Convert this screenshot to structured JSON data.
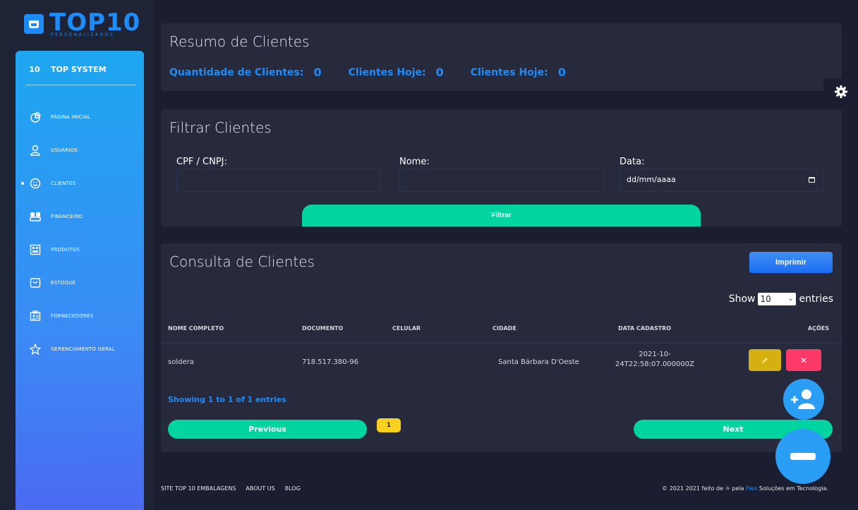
{
  "logo": {
    "main": "TOP10",
    "sub": "PERSONALIZADOS"
  },
  "brand": {
    "num": "10",
    "name": "TOP SYSTEM"
  },
  "nav": [
    {
      "label": "PÁGINA INICIAL",
      "icon": "pie-chart-icon"
    },
    {
      "label": "USUÁRIOS",
      "icon": "user-icon"
    },
    {
      "label": "CLIENTES",
      "icon": "smile-icon",
      "active": true
    },
    {
      "label": "FINANCEIRO",
      "icon": "money-icon"
    },
    {
      "label": "PRODUTOS",
      "icon": "product-icon"
    },
    {
      "label": "ESTOQUE",
      "icon": "stock-icon"
    },
    {
      "label": "FORNECEDORES",
      "icon": "supplier-icon"
    },
    {
      "label": "GERENCIAMENTO GERAL",
      "icon": "gear-star-icon"
    }
  ],
  "summary": {
    "title": "Resumo de Clientes",
    "stats": [
      {
        "label": "Quantidade de Clientes:",
        "value": "0"
      },
      {
        "label": "Clientes Hoje:",
        "value": "0"
      },
      {
        "label": "Clientes Hoje:",
        "value": "0"
      }
    ]
  },
  "filter": {
    "title": "Filtrar Clientes",
    "cpf_label": "CPF / CNPJ:",
    "nome_label": "Nome:",
    "data_label": "Data:",
    "date_placeholder": "dd/mm/aaaa",
    "button": "Filtrar"
  },
  "consulta": {
    "title": "Consulta de Clientes",
    "print_button": "Imprimir",
    "show_label": "Show",
    "entries_value": "10",
    "entries_label": "entries",
    "columns": [
      "NOME COMPLETO",
      "DOCUMENTO",
      "CELULAR",
      "CIDADE",
      "DATA CADASTRO",
      "AÇÕES"
    ],
    "rows": [
      {
        "nome": "soldera",
        "documento": "718.517.380-96",
        "celular": "",
        "cidade": "Santa Bárbara D'Oeste",
        "data_line1": "2021-10-",
        "data_line2": "24T22:58:07.000000Z"
      }
    ],
    "showing": "Showing 1 to 1 of 1 entries",
    "previous": "Previous",
    "page": "1",
    "next": "Next"
  },
  "footer": {
    "links": [
      "SITE TOP 10 EMBALAGENS",
      "ABOUT US",
      "BLOG"
    ],
    "copy_prefix": "© 2021 2021 feito de ☼ pela ",
    "copy_brand": "Flex",
    "copy_suffix": " Soluções em Tecnologia."
  },
  "colors": {
    "accent": "#1d8cf8",
    "teal": "#00d4a0",
    "yellow": "#d4b110",
    "red": "#fd3a67",
    "card": "#27293d",
    "bg": "#1a1e30"
  }
}
